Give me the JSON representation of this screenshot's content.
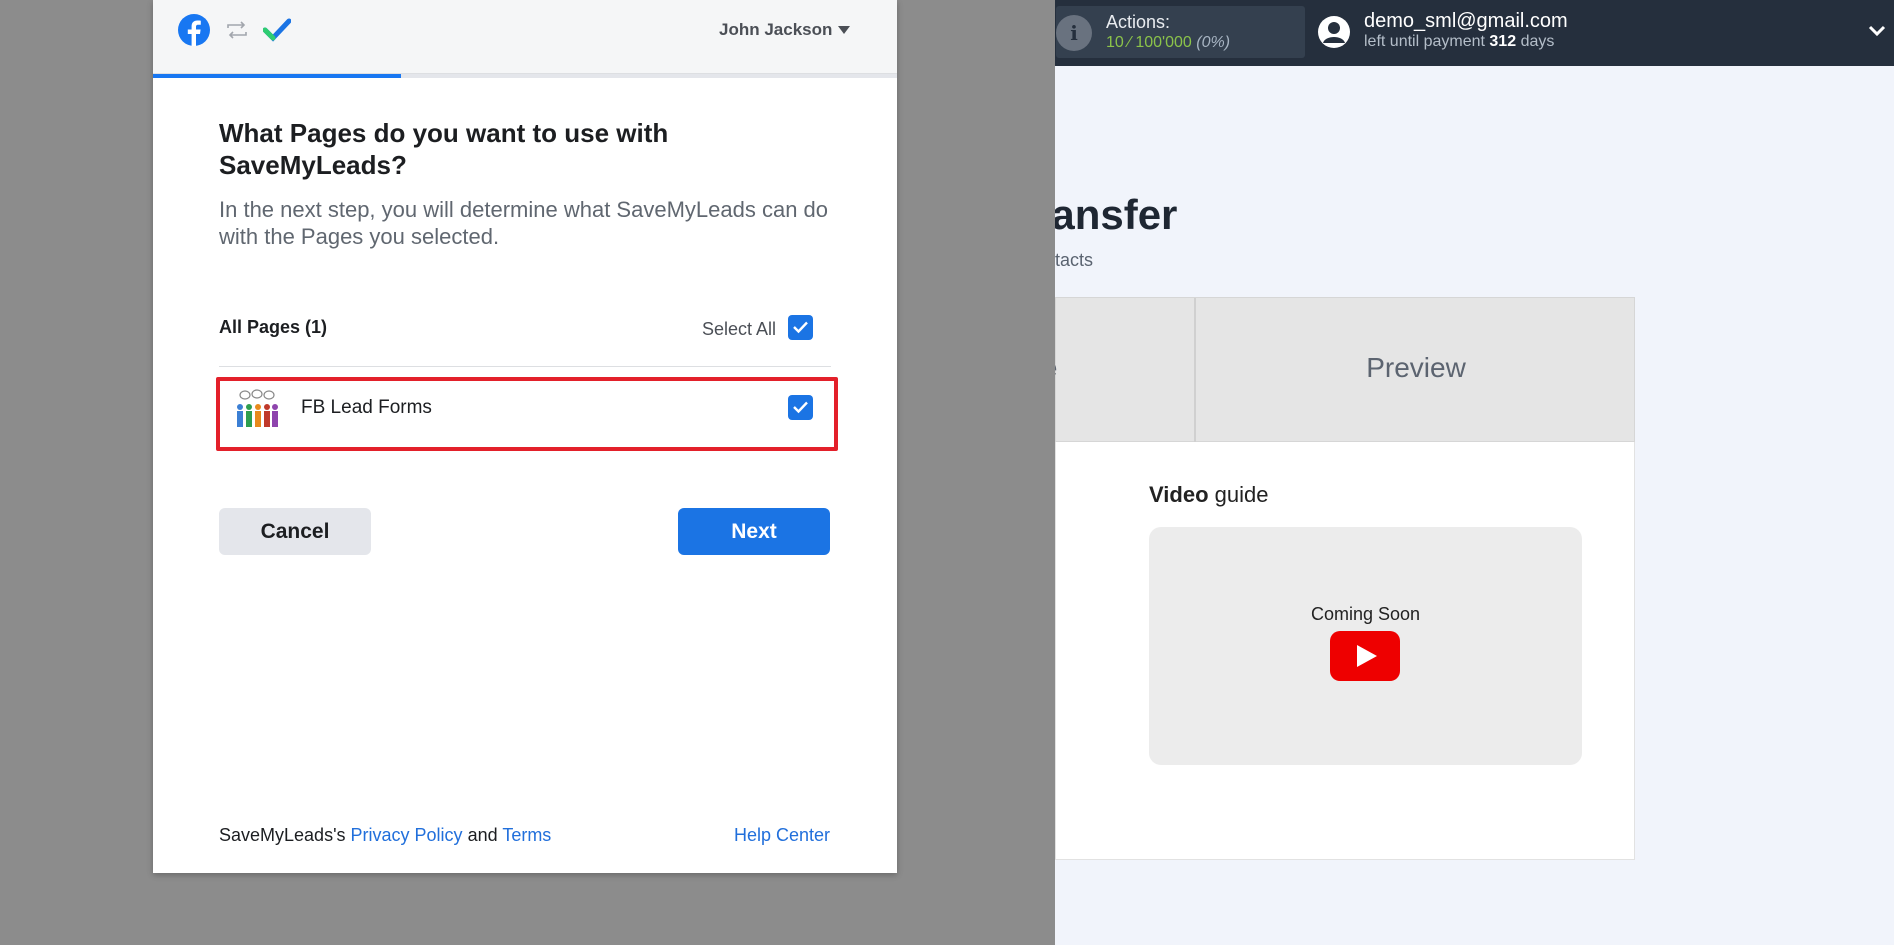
{
  "app": {
    "topbar": {
      "actions_label": "Actions:",
      "actions_value": "10 ⁄ 100'000",
      "actions_pct": "(0%)",
      "user_email": "demo_sml@gmail.com",
      "payment_prefix": "left until payment",
      "payment_days": "312",
      "payment_suffix": "days"
    },
    "page_title_fragment": "ransfer",
    "page_subtitle_fragment": "ontacts",
    "tabs": {
      "left_fragment": "se",
      "preview": "Preview"
    },
    "video": {
      "title_bold": "Video",
      "title_rest": "guide",
      "coming_soon": "Coming Soon"
    }
  },
  "dialog": {
    "account_name": "John Jackson",
    "progress_fraction": 0.333,
    "title": "What Pages do you want to use with SaveMyLeads?",
    "description": "In the next step, you will determine what SaveMyLeads can do with the Pages you selected.",
    "all_pages_label": "All Pages (1)",
    "select_all_label": "Select All",
    "select_all_checked": true,
    "pages": [
      {
        "name": "FB Lead Forms",
        "checked": true
      }
    ],
    "cancel_label": "Cancel",
    "next_label": "Next",
    "footer": {
      "prefix": "SaveMyLeads's",
      "privacy": "Privacy Policy",
      "and": "and",
      "terms": "Terms",
      "help": "Help Center"
    }
  },
  "colors": {
    "fb_blue": "#1b74e4",
    "highlight_red": "#e3202a",
    "topbar_bg": "#252f3d",
    "actions_green": "#8bc34a"
  },
  "icons": {
    "brand": "facebook-icon",
    "swap": "swap-arrows-icon",
    "logo": "checkmark-logo-icon",
    "caret": "caret-down-icon",
    "info": "info-icon",
    "user": "user-avatar-icon",
    "chevron": "chevron-down-icon",
    "play": "youtube-play-icon"
  }
}
